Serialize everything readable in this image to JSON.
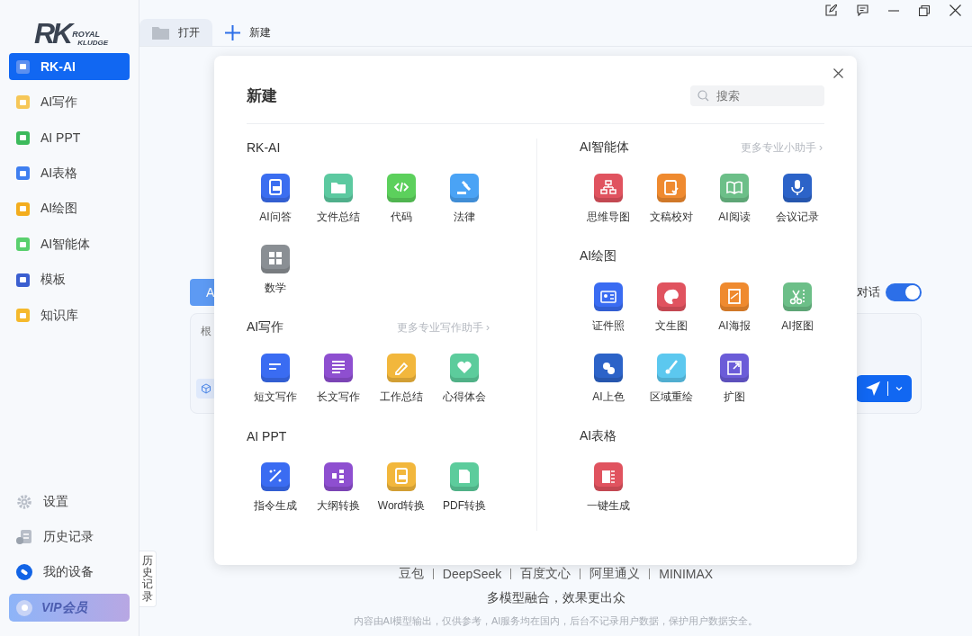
{
  "sidebar": {
    "logo": {
      "mark": "RK",
      "line1": "ROYAL",
      "line2": "KLUDGE"
    },
    "nav": [
      {
        "label": "RK-AI",
        "color": "#5b8ff0",
        "selected": true
      },
      {
        "label": "AI写作",
        "color": "#f6c758",
        "selected": false
      },
      {
        "label": "AI PPT",
        "color": "#3cba5c",
        "selected": false
      },
      {
        "label": "AI表格",
        "color": "#3f7ff0",
        "selected": false
      },
      {
        "label": "AI绘图",
        "color": "#f3ad1e",
        "selected": false
      },
      {
        "label": "AI智能体",
        "color": "#5ad06e",
        "selected": false
      },
      {
        "label": "模板",
        "color": "#3b5fd0",
        "selected": false
      },
      {
        "label": "知识库",
        "color": "#f5b92c",
        "selected": false
      }
    ],
    "footer": [
      {
        "label": "设置",
        "kind": "gear"
      },
      {
        "label": "历史记录",
        "kind": "history"
      },
      {
        "label": "我的设备",
        "kind": "device"
      }
    ],
    "vip": "VIP会员"
  },
  "tabs": [
    {
      "label": "打开",
      "kind": "open",
      "selected": true
    },
    {
      "label": "新建",
      "kind": "new",
      "selected": false
    }
  ],
  "chat": {
    "mode_button": "A",
    "placeholder": "根",
    "toggle": {
      "label": "对话",
      "on": true
    }
  },
  "models": [
    "豆包",
    "DeepSeek",
    "百度文心",
    "阿里通义",
    "MINIMAX"
  ],
  "slogan": "多模型融合，效果更出众",
  "disclaimer": "内容由AI模型输出，仅供参考，AI服务均在国内，后台不记录用户数据，保护用户数据安全。",
  "history_tab": "历史记录",
  "modal": {
    "title": "新建",
    "search": {
      "placeholder": "搜索"
    },
    "columns": [
      {
        "sections": [
          {
            "title": "RK-AI",
            "items": [
              {
                "label": "AI问答",
                "kind": "doc",
                "color": "#3b6ef0"
              },
              {
                "label": "文件总结",
                "kind": "folder",
                "color": "#5cc9a0"
              },
              {
                "label": "代码",
                "kind": "code",
                "color": "#5cd05c"
              },
              {
                "label": "法律",
                "kind": "gavel",
                "color": "#4aa3f5"
              },
              {
                "label": "数学",
                "kind": "calc",
                "color": "#8a8f94"
              }
            ]
          },
          {
            "title": "AI写作",
            "more": "更多专业写作助手 ›",
            "items": [
              {
                "label": "短文写作",
                "kind": "lines",
                "color": "#3a6cf2"
              },
              {
                "label": "长文写作",
                "kind": "list",
                "color": "#8e4fd0"
              },
              {
                "label": "工作总结",
                "kind": "pencil",
                "color": "#f2b73c"
              },
              {
                "label": "心得体会",
                "kind": "heart",
                "color": "#5ccc9c"
              }
            ]
          },
          {
            "title": "AI PPT",
            "items": [
              {
                "label": "指令生成",
                "kind": "sparkle",
                "color": "#3a6cf2"
              },
              {
                "label": "大纲转换",
                "kind": "outline",
                "color": "#8e4fd0"
              },
              {
                "label": "Word转换",
                "kind": "doc",
                "color": "#f2b73c"
              },
              {
                "label": "PDF转换",
                "kind": "pdf",
                "color": "#5ccc9c"
              }
            ]
          }
        ]
      },
      {
        "sections": [
          {
            "title": "AI智能体",
            "more": "更多专业小助手 ›",
            "items": [
              {
                "label": "思维导图",
                "kind": "tree",
                "color": "#e0535f"
              },
              {
                "label": "文稿校对",
                "kind": "check",
                "color": "#ef8a2f"
              },
              {
                "label": "AI阅读",
                "kind": "book",
                "color": "#6cbf88"
              },
              {
                "label": "会议记录",
                "kind": "mic",
                "color": "#2c63c8"
              }
            ]
          },
          {
            "title": "AI绘图",
            "items": [
              {
                "label": "证件照",
                "kind": "id",
                "color": "#3a6cf2"
              },
              {
                "label": "文生图",
                "kind": "palette",
                "color": "#e0535f"
              },
              {
                "label": "AI海报",
                "kind": "poster",
                "color": "#ef8a2f"
              },
              {
                "label": "AI抠图",
                "kind": "scissors",
                "color": "#6cbf88"
              },
              {
                "label": "AI上色",
                "kind": "drops",
                "color": "#2c63c8"
              },
              {
                "label": "区域重绘",
                "kind": "brush",
                "color": "#5cc8ef"
              },
              {
                "label": "扩图",
                "kind": "expand",
                "color": "#6b5cd8"
              }
            ]
          },
          {
            "title": "AI表格",
            "items": [
              {
                "label": "一键生成",
                "kind": "sheet",
                "color": "#e0535f"
              }
            ]
          }
        ]
      }
    ]
  }
}
